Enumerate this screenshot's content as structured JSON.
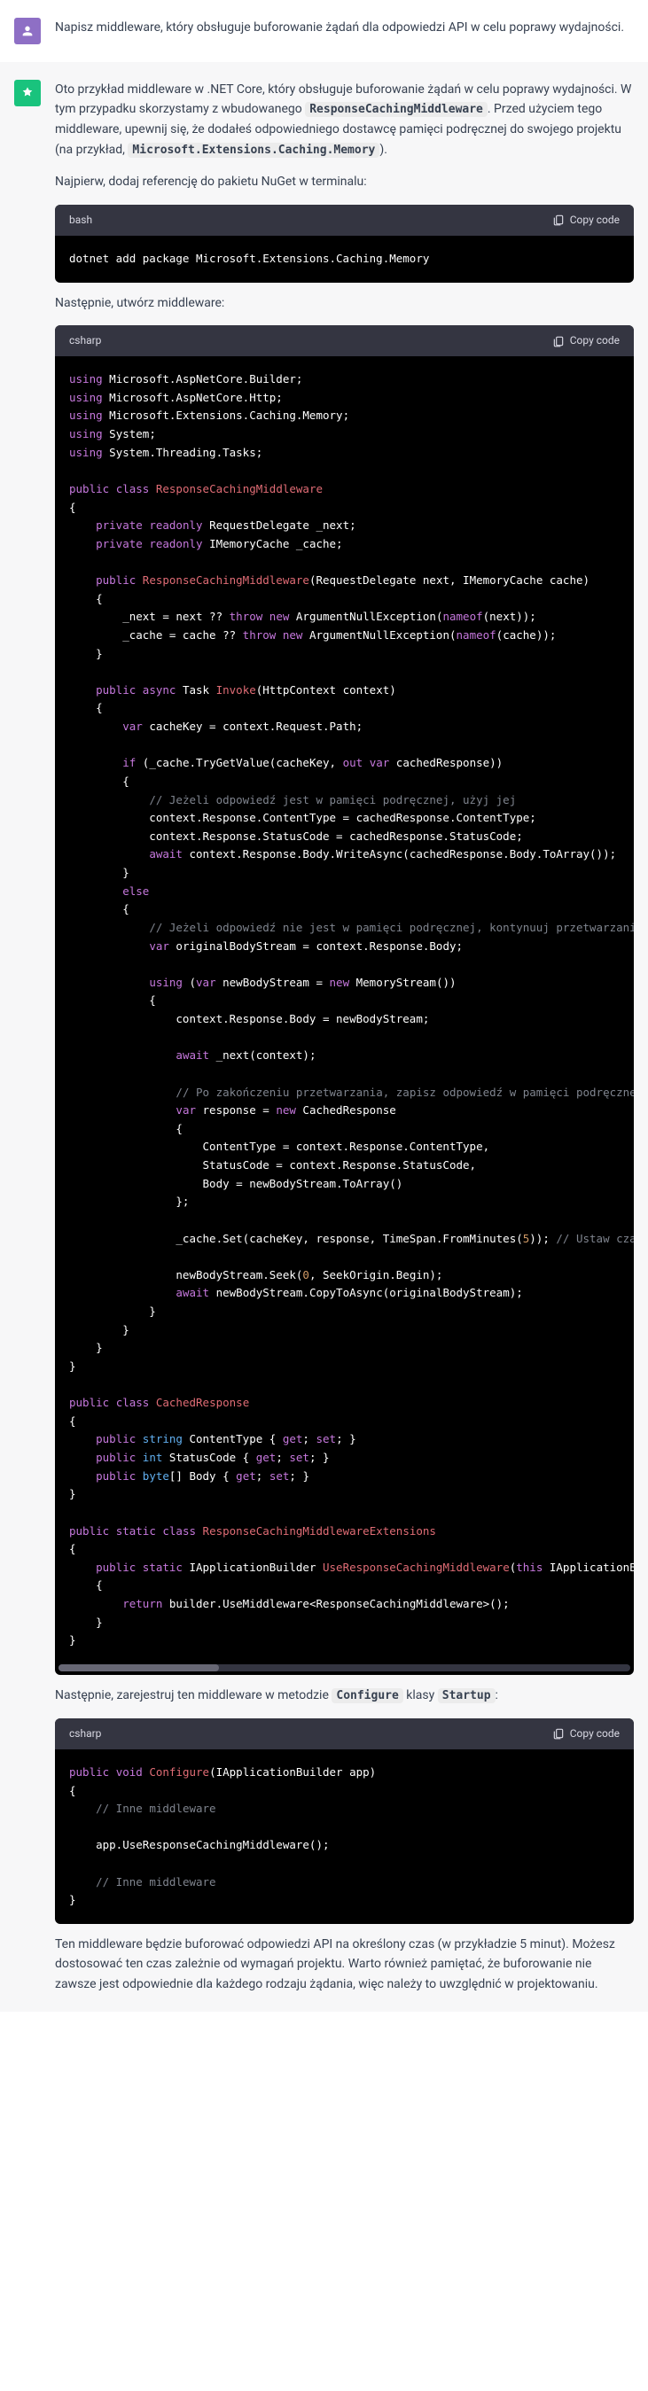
{
  "user": {
    "prompt": "Napisz middleware, który obsługuje buforowanie żądań dla odpowiedzi API w celu poprawy wydajności."
  },
  "assistant": {
    "intro1": "Oto przykład middleware w .NET Core, który obsługuje buforowanie żądań w celu poprawy wydajności. W tym przypadku skorzystamy z wbudowanego ",
    "ic1": "ResponseCachingMiddleware",
    "intro2": ". Przed użyciem tego middleware, upewnij się, że dodałeś odpowiedniego dostawcę pamięci podręcznej do swojego projektu (na przykład, ",
    "ic2": "Microsoft.Extensions.Caching.Memory",
    "intro3": ").",
    "p2": "Najpierw, dodaj referencję do pakietu NuGet w terminalu:",
    "p3": "Następnie, utwórz middleware:",
    "p4a": "Następnie, zarejestruj ten middleware w metodzie ",
    "ic3": "Configure",
    "p4b": " klasy ",
    "ic4": "Startup",
    "p4c": ":",
    "p5": "Ten middleware będzie buforować odpowiedzi API na określony czas (w przykładzie 5 minut). Możesz dostosować ten czas zależnie od wymagań projektu. Warto również pamiętać, że buforowanie nie zawsze jest odpowiednie dla każdego rodzaju żądania, więc należy to uwzględnić w projektowaniu."
  },
  "code": {
    "lang_bash": "bash",
    "lang_csharp": "csharp",
    "copy": "Copy code",
    "bash": "dotnet add package Microsoft.Extensions.Caching.Memory"
  }
}
